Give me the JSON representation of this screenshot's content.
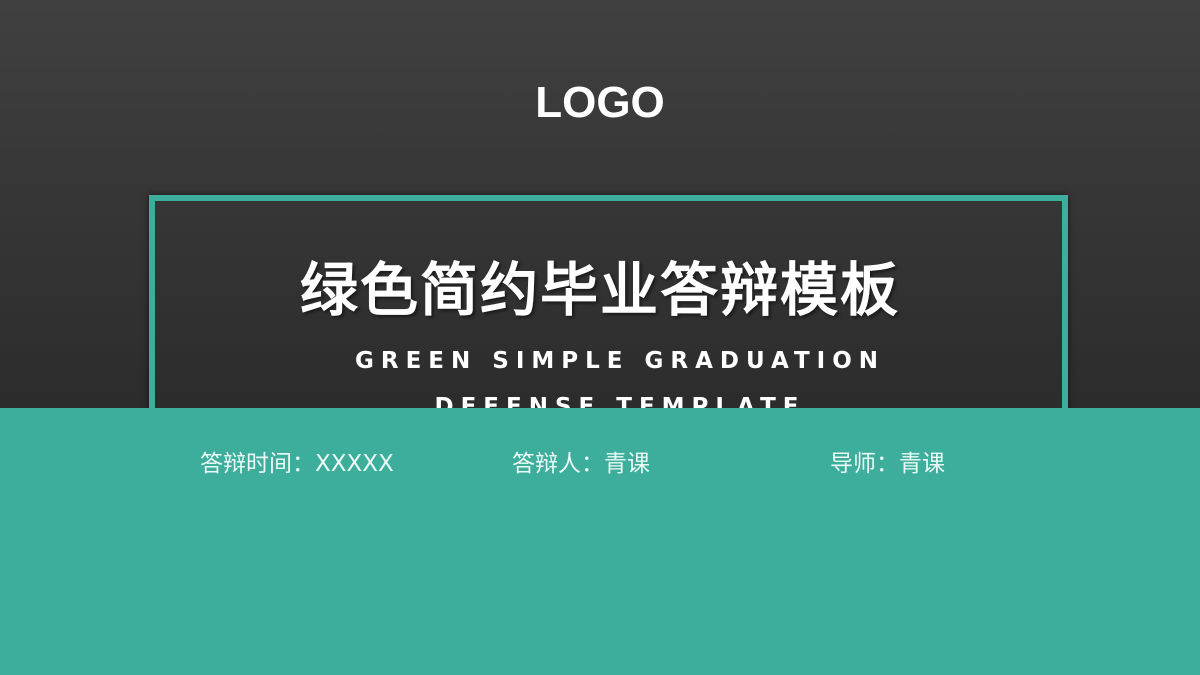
{
  "logo": "LOGO",
  "title": "绿色简约毕业答辩模板",
  "subtitle": "GREEN SIMPLE GRADUATION DEFENSE TEMPLATE",
  "info": {
    "time": "答辩时间：XXXXX",
    "presenter": "答辩人：青课",
    "advisor": "导师：青课"
  },
  "colors": {
    "accent": "#3dae9c",
    "background": "#333333"
  }
}
